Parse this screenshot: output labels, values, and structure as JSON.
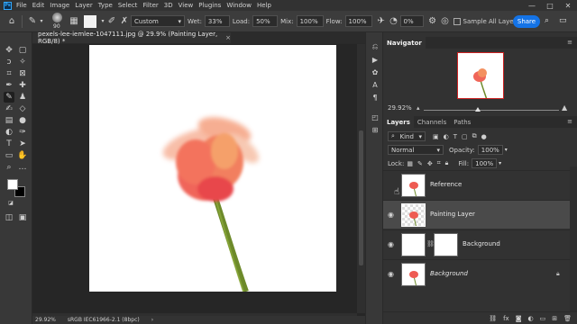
{
  "menubar": {
    "logo": "Ps",
    "items": [
      "File",
      "Edit",
      "Image",
      "Layer",
      "Type",
      "Select",
      "Filter",
      "3D",
      "View",
      "Plugins",
      "Window",
      "Help"
    ],
    "controls": [
      "—",
      "□",
      "✕"
    ]
  },
  "options": {
    "brush_size": "90",
    "mode_value": "Custom",
    "wet_label": "Wet:",
    "wet_value": "33%",
    "load_label": "Load:",
    "load_value": "50%",
    "mix_label": "Mix:",
    "mix_value": "100%",
    "flow_label": "Flow:",
    "flow_value": "100%",
    "angle_value": "0%",
    "sample_all_label": "Sample All Laye",
    "share_label": "Share"
  },
  "document": {
    "tab_title": "pexels-lee-iemlee-1047111.jpg @ 29.9% (Painting Layer, RGB/8) *",
    "close": "×"
  },
  "status": {
    "zoom": "29.92%",
    "profile": "sRGB IEC61966-2.1 (8bpc)",
    "arrow": "›"
  },
  "navigator": {
    "tab": "Navigator",
    "zoom": "29.92%"
  },
  "layers_panel": {
    "tabs": [
      "Layers",
      "Channels",
      "Paths"
    ],
    "filter_kind": "Kind",
    "blend_mode": "Normal",
    "opacity_label": "Opacity:",
    "opacity_value": "100%",
    "lock_label": "Lock:",
    "fill_label": "Fill:",
    "fill_value": "100%",
    "layers": [
      {
        "name": "Reference",
        "visible": false,
        "selected": false
      },
      {
        "name": "Painting Layer",
        "visible": true,
        "selected": true
      },
      {
        "name": "Background",
        "visible": true,
        "selected": false
      },
      {
        "name": "Background",
        "visible": true,
        "selected": false,
        "italic": true,
        "locked": true
      }
    ],
    "footer_icons": [
      "link-icon",
      "fx-icon",
      "mask-icon",
      "adjustment-icon",
      "group-icon",
      "new-layer-icon",
      "trash-icon"
    ]
  },
  "colors": {
    "accent": "#1473e6",
    "panel_bg": "#323232",
    "canvas_bg": "#262626",
    "selected_layer": "#4a4a4a"
  }
}
